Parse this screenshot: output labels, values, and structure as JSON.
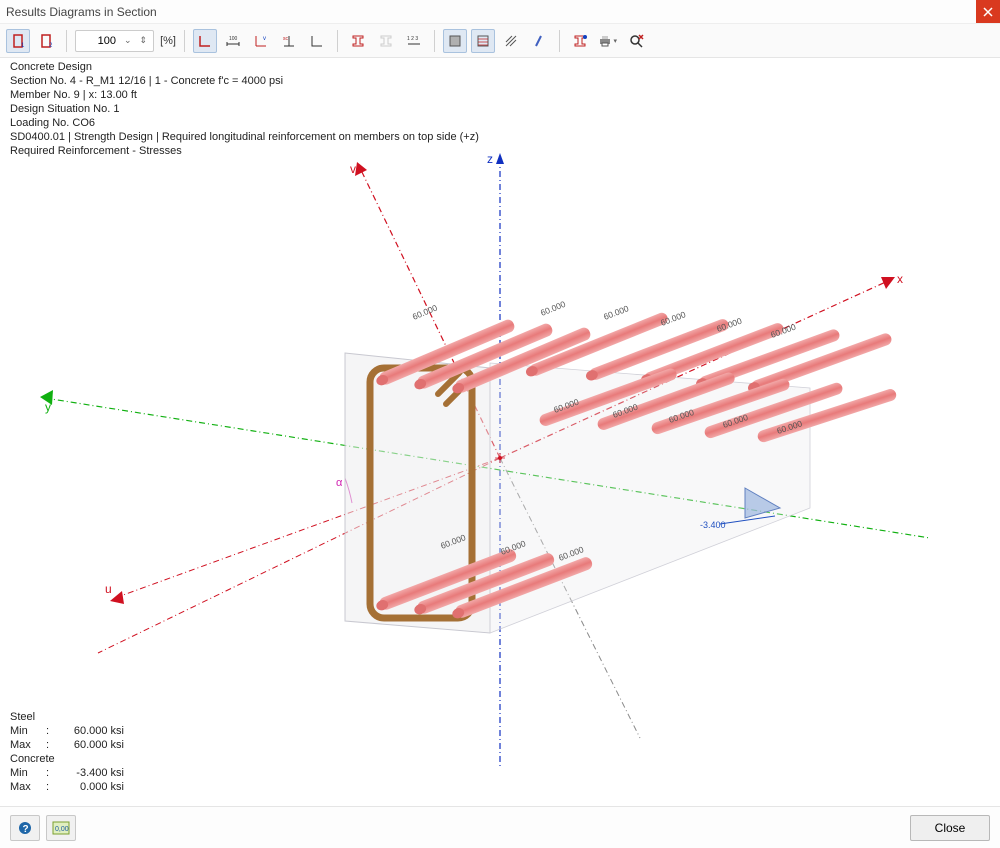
{
  "window": {
    "title": "Results Diagrams in Section"
  },
  "toolbar": {
    "zoom_value": "100",
    "zoom_unit": "[%]"
  },
  "info": {
    "l1": "Concrete Design",
    "l2": "Section No. 4 - R_M1 12/16 | 1 - Concrete f'c = 4000 psi",
    "l3": "Member No. 9 | x: 13.00 ft",
    "l4": "Design Situation No. 1",
    "l5": "Loading No. CO6",
    "l6": "SD0400.01 | Strength Design | Required longitudinal reinforcement on members on top side (+z)",
    "l7": "Required Reinforcement - Stresses"
  },
  "axes": {
    "z": "z",
    "v": "v",
    "x": "x",
    "y": "y",
    "u": "u",
    "alpha": "α"
  },
  "chart_data": {
    "type": "table",
    "title": "Rebar stress labels",
    "columns": [
      "label"
    ],
    "values": [
      "60.000",
      "60.000",
      "60.000",
      "60.000",
      "60.000",
      "60.000",
      "60.000",
      "60.000",
      "60.000",
      "60.000",
      "60.000",
      "60.000",
      "60.000",
      "60.000",
      "-3.400"
    ],
    "unit": "ksi"
  },
  "bars": {
    "b1": "60.000",
    "b2": "60.000",
    "b3": "60.000",
    "b4": "60.000",
    "b5": "60.000",
    "b6": "60.000",
    "b7": "60.000",
    "b8": "60.000",
    "b9": "60.000",
    "b10": "60.000",
    "b11": "60.000",
    "b12": "60.000",
    "b13": "60.000",
    "b14": "60.000",
    "concrete_val": "-3.400"
  },
  "results": {
    "steel_label": "Steel",
    "min_label": "Min",
    "max_label": "Max",
    "concrete_label": "Concrete",
    "steel_min": "60.000 ksi",
    "steel_max": "60.000 ksi",
    "concrete_min": "-3.400 ksi",
    "concrete_max": "0.000 ksi"
  },
  "footer": {
    "close_label": "Close"
  }
}
